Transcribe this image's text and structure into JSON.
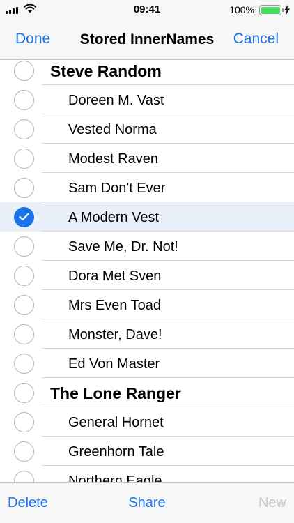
{
  "status_bar": {
    "time": "09:41",
    "battery_percent": "100%",
    "battery_level": 1.0,
    "icons": [
      "signal-icon",
      "wifi-icon",
      "battery-icon",
      "charging-bolt-icon"
    ]
  },
  "nav": {
    "left_label": "Done",
    "title": "Stored InnerNames",
    "right_label": "Cancel"
  },
  "list": {
    "rows": [
      {
        "type": "group",
        "label": "Steve Random",
        "checked": false
      },
      {
        "type": "item",
        "label": "Doreen M. Vast",
        "checked": false
      },
      {
        "type": "item",
        "label": "Vested Norma",
        "checked": false
      },
      {
        "type": "item",
        "label": "Modest Raven",
        "checked": false
      },
      {
        "type": "item",
        "label": "Sam Don't Ever",
        "checked": false
      },
      {
        "type": "item",
        "label": "A Modern Vest",
        "checked": true
      },
      {
        "type": "item",
        "label": "Save Me, Dr. Not!",
        "checked": false
      },
      {
        "type": "item",
        "label": "Dora Met Sven",
        "checked": false
      },
      {
        "type": "item",
        "label": "Mrs Even Toad",
        "checked": false
      },
      {
        "type": "item",
        "label": "Monster, Dave!",
        "checked": false
      },
      {
        "type": "item",
        "label": "Ed Von Master",
        "checked": false
      },
      {
        "type": "group",
        "label": "The Lone Ranger",
        "checked": false
      },
      {
        "type": "item",
        "label": "General Hornet",
        "checked": false
      },
      {
        "type": "item",
        "label": "Greenhorn Tale",
        "checked": false
      },
      {
        "type": "item",
        "label": "Northern Eagle",
        "checked": false
      }
    ]
  },
  "toolbar": {
    "delete_label": "Delete",
    "share_label": "Share",
    "new_label": "New"
  },
  "colors": {
    "accent": "#1a73e8",
    "selected_row": "#e9eff9",
    "disabled": "#c7c7cc",
    "battery": "#4cd964"
  }
}
